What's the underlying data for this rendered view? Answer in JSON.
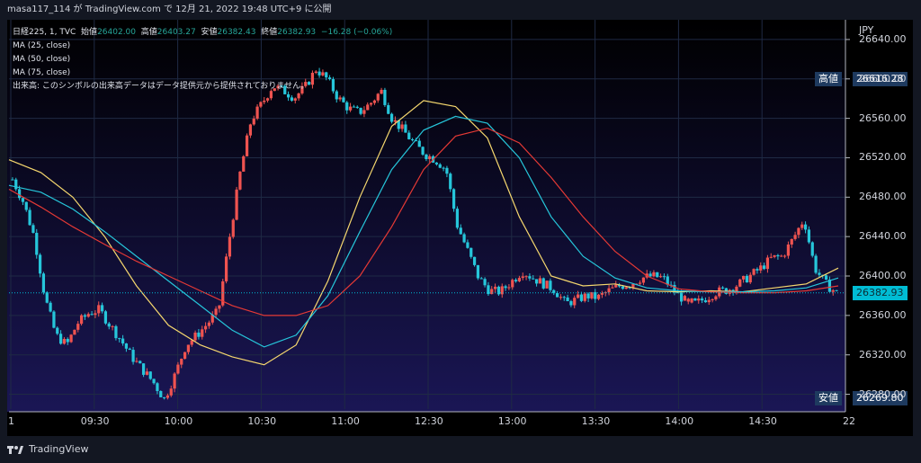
{
  "header": {
    "text": "masa117_114 が TradingView.com で 12月 21, 2022 19:48 UTC+9 に公開"
  },
  "legend": {
    "symbol": "日経225, 1, TVC",
    "open_label": "始値",
    "open_value": "26402.00",
    "high_label": "高値",
    "high_value": "26403.27",
    "low_label": "安値",
    "low_value": "26382.43",
    "close_label": "終値",
    "close_value": "26382.93",
    "change": "−16.28 (−0.06%)",
    "ma25": "MA (25, close)",
    "ma50": "MA (50, close)",
    "ma75": "MA (75, close)",
    "volume_note": "出来高: このシンボルの出来高データはデータ提供元から提供されておりません。"
  },
  "price_axis": {
    "currency": "JPY",
    "high_label": "高値",
    "high_value": "26616.28",
    "low_label": "安値",
    "low_value": "26269.80",
    "last_value": "26382.93"
  },
  "brand": {
    "name": "TradingView"
  },
  "colors": {
    "background": "#000000",
    "up": "#ef5350",
    "down": "#26c6da",
    "ma25": "#f5d76e",
    "ma50": "#26c6da",
    "ma75": "#e53935",
    "last_price": "#00bcd4"
  },
  "chart_data": {
    "type": "candlestick",
    "title": "日経225, 1, TVC",
    "y_ticks": [
      26280,
      26320,
      26360,
      26400,
      26440,
      26480,
      26520,
      26560,
      26600,
      26640
    ],
    "ylim": [
      26265,
      26660
    ],
    "x_ticks": [
      "1",
      "09:30",
      "10:00",
      "10:30",
      "11:00",
      "12:30",
      "13:00",
      "13:30",
      "14:00",
      "14:30",
      "22"
    ],
    "series": [
      {
        "name": "MA (25, close)",
        "values": [
          26518,
          26505,
          26480,
          26440,
          26390,
          26350,
          26330,
          26318,
          26310,
          26330,
          26395,
          26480,
          26552,
          26578,
          26572,
          26540,
          26460,
          26400,
          26390,
          26392,
          26385,
          26384,
          26385,
          26384,
          26388,
          26392,
          26408
        ]
      },
      {
        "name": "MA (50, close)",
        "values": [
          26492,
          26485,
          26468,
          26445,
          26420,
          26395,
          26370,
          26345,
          26328,
          26340,
          26380,
          26445,
          26508,
          26548,
          26562,
          26555,
          26520,
          26460,
          26420,
          26398,
          26388,
          26385,
          26384,
          26384,
          26385,
          26388,
          26398
        ]
      },
      {
        "name": "MA (75, close)",
        "values": [
          26488,
          26470,
          26450,
          26432,
          26415,
          26400,
          26385,
          26370,
          26360,
          26360,
          26370,
          26400,
          26450,
          26508,
          26542,
          26550,
          26535,
          26500,
          26460,
          26425,
          26400,
          26387,
          26384,
          26383,
          26383,
          26385,
          26390
        ]
      }
    ],
    "close_path": [
      26498,
      26475,
      26440,
      26378,
      26340,
      26330,
      26352,
      26362,
      26366,
      26350,
      26335,
      26318,
      26305,
      26292,
      26275,
      26300,
      26330,
      26340,
      26352,
      26365,
      26438,
      26505,
      26558,
      26575,
      26593,
      26588,
      26581,
      26592,
      26610,
      26600,
      26581,
      26570,
      26566,
      26575,
      26588,
      26560,
      26548,
      26535,
      26524,
      26518,
      26508,
      26452,
      26425,
      26398,
      26385,
      26384,
      26394,
      26405,
      26398,
      26392,
      26386,
      26372,
      26376,
      26380,
      26378,
      26385,
      26390,
      26392,
      26398,
      26400,
      26398,
      26385,
      26375,
      26372,
      26378,
      26384,
      26386,
      26392,
      26400,
      26408,
      26418,
      26420,
      26438,
      26458,
      26408,
      26392,
      26383
    ],
    "high": 26616.28,
    "low": 26269.8,
    "last": 26382.93
  }
}
